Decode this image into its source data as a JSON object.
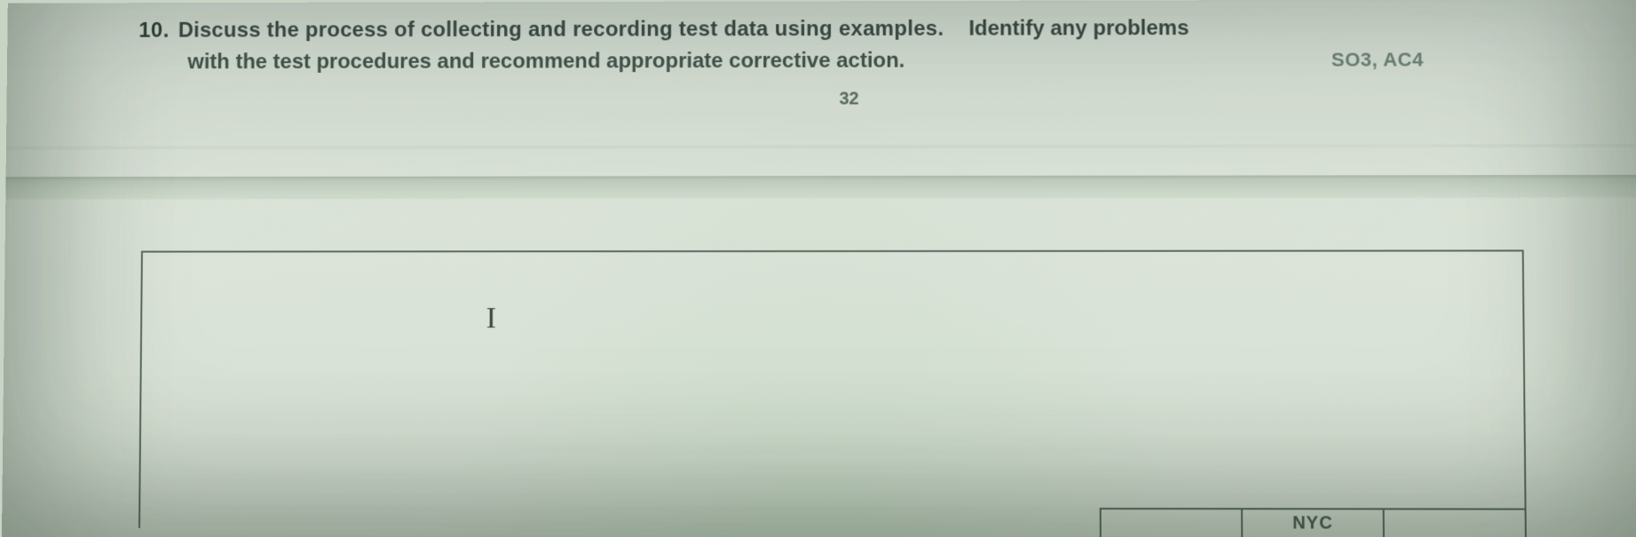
{
  "question": {
    "number": "10.",
    "line1_main": "Discuss the process of collecting and recording test data using examples.",
    "line1_tail": "Identify any problems",
    "line2": "with the test procedures and recommend appropriate corrective action.",
    "code": "SO3, AC4"
  },
  "page_number": "32",
  "answer": {
    "cursor_glyph": "I"
  },
  "footer_cells": {
    "label": "NYC"
  }
}
